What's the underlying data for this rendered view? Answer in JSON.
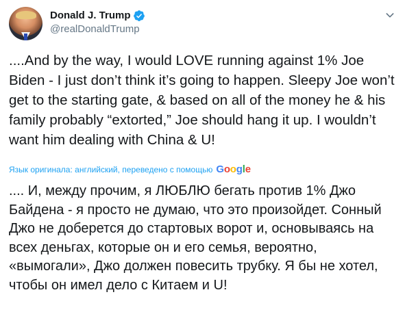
{
  "author": {
    "display_name": "Donald J. Trump",
    "handle": "@realDonaldTrump",
    "verified": true,
    "avatar": "profile-photo"
  },
  "icons": {
    "verified": "verified-badge-icon",
    "menu": "chevron-down-icon"
  },
  "colors": {
    "link": "#1da1f2",
    "text": "#14171a",
    "muted": "#657786",
    "verified": "#1da1f2"
  },
  "tweet": {
    "original_text": "....And by the way, I would LOVE running against 1% Joe Biden - I just don’t think it’s going to happen. Sleepy Joe won’t get to the starting gate, & based on all of the money he & his family probably “extorted,” Joe should hang it up. I wouldn’t want him dealing with China & U!",
    "translation_label": "Язык оригинала: английский, переведено с помощью",
    "translation_provider": "Google",
    "translated_text": ".... И, между прочим, я ЛЮБЛЮ бегать против 1% Джо Байдена - я просто не думаю, что это произойдет. Сонный Джо не доберется до стартовых ворот и, основываясь на всех деньгах, которые он и его семья, вероятно, «вымогали», Джо должен повесить трубку. Я бы не хотел, чтобы он имел дело с Китаем и U!"
  }
}
